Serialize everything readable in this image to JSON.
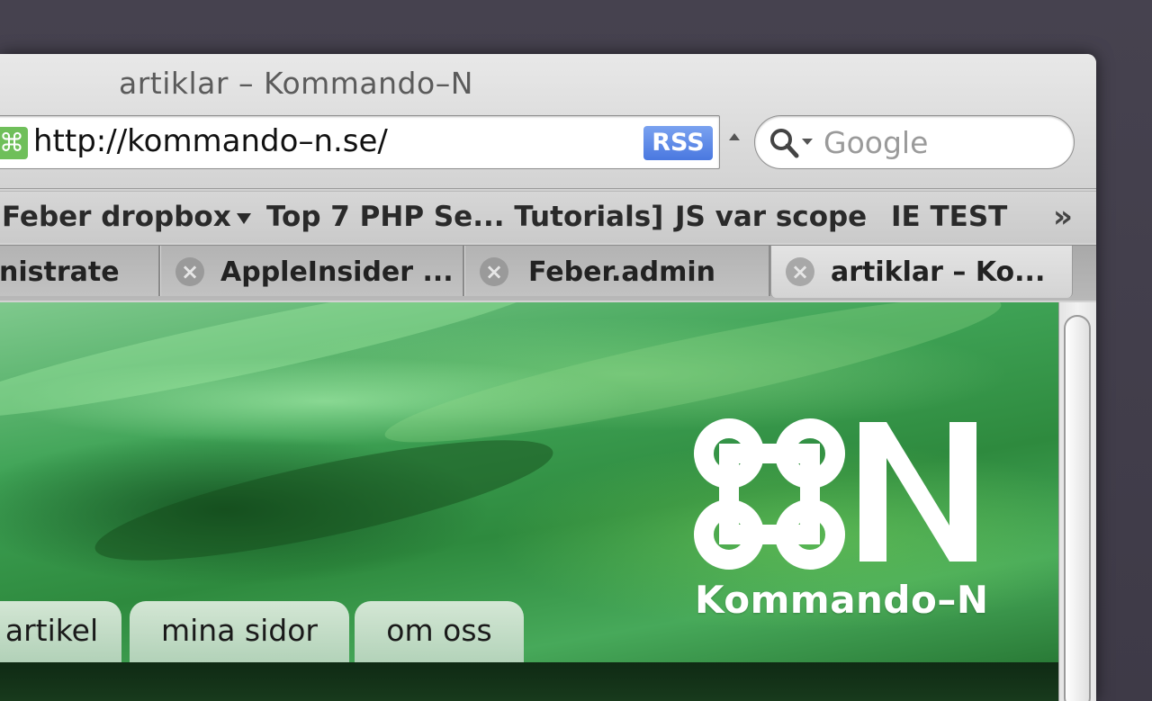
{
  "window": {
    "title": "artiklar – Kommando–N"
  },
  "address_bar": {
    "url": "http://kommando–n.se/",
    "rss_label": "RSS",
    "favicon_glyph": "⌘"
  },
  "search": {
    "placeholder": "Google",
    "icon": "magnifier-icon"
  },
  "bookmarks": {
    "items": [
      {
        "label": "Feber dropbox",
        "has_menu": true
      },
      {
        "label": "Top 7 PHP Se... Tutorials]"
      },
      {
        "label": "JS var scope"
      },
      {
        "label": "IE TEST"
      }
    ],
    "overflow_glyph": "»"
  },
  "tabs": [
    {
      "label": "nistrate",
      "active": false
    },
    {
      "label": "AppleInsider ...",
      "active": false
    },
    {
      "label": "Feber.admin",
      "active": false
    },
    {
      "label": "artiklar – Ko...",
      "active": true
    }
  ],
  "tab_close_glyph": "×",
  "page": {
    "logo_text": "Kommando–N",
    "logo_icon": "command-key-icon",
    "nav": [
      {
        "label": "artikel"
      },
      {
        "label": "mina sidor"
      },
      {
        "label": "om oss"
      }
    ]
  },
  "colors": {
    "rss_badge": "#4a78e0",
    "page_green": "#2e8a3e"
  }
}
